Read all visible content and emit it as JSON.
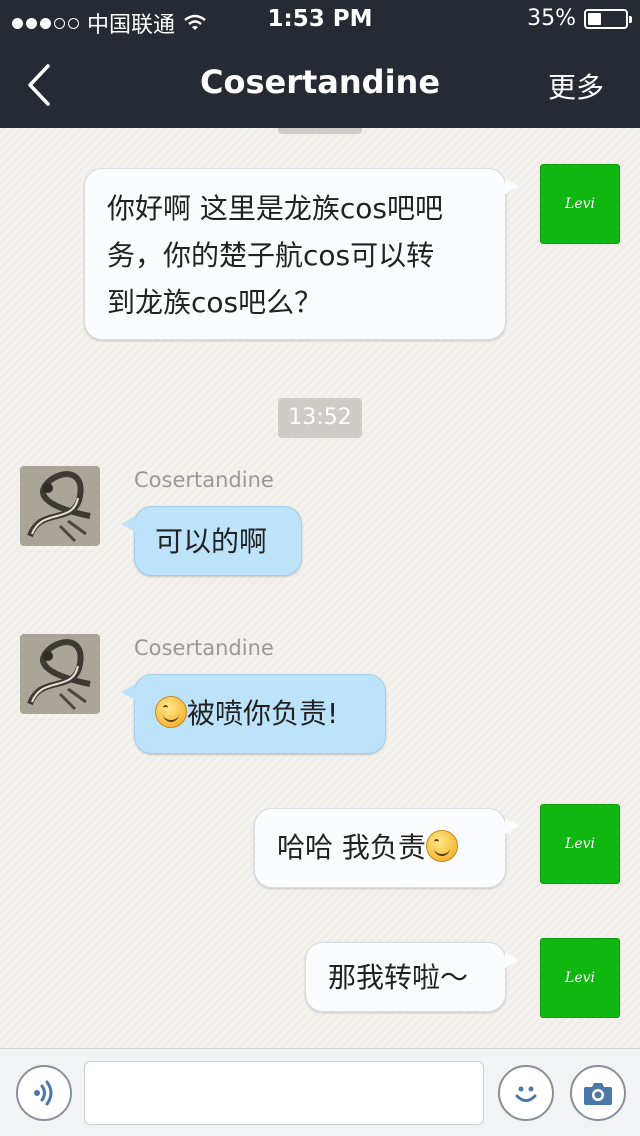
{
  "status_bar": {
    "carrier": "中国联通",
    "time": "1:53 PM",
    "battery_text": "35%",
    "battery_level": 0.35,
    "signal_bars": 3,
    "signal_total": 5
  },
  "nav": {
    "title": "Cosertandine",
    "more_label": "更多",
    "back_icon": "chevron-left-icon"
  },
  "messages": {
    "m1": {
      "sender": "me",
      "text_lines": [
        "你好啊 这里是龙族cos吧吧",
        "务，你的楚子航cos可以转",
        "到龙族cos吧么？"
      ],
      "avatar_label": "Levi"
    },
    "timestamp": "13:52",
    "m2": {
      "sender_name": "Cosertandine",
      "text": "可以的啊"
    },
    "m3": {
      "sender_name": "Cosertandine",
      "text": "被喷你负责!",
      "emoji": "smile-emoji"
    },
    "m4": {
      "text": "哈哈 我负责",
      "emoji": "smile-emoji",
      "avatar_label": "Levi"
    },
    "m5": {
      "text": "那我转啦～",
      "avatar_label": "Levi"
    }
  },
  "input_bar": {
    "voice_icon": "voice-icon",
    "text_value": "",
    "emoji_icon": "emoji-icon",
    "camera_icon": "camera-icon"
  },
  "colors": {
    "header_bg": "#262a33",
    "my_bubble": "#fafcfe",
    "their_bubble": "#bde3fb",
    "my_avatar": "#11b711"
  }
}
